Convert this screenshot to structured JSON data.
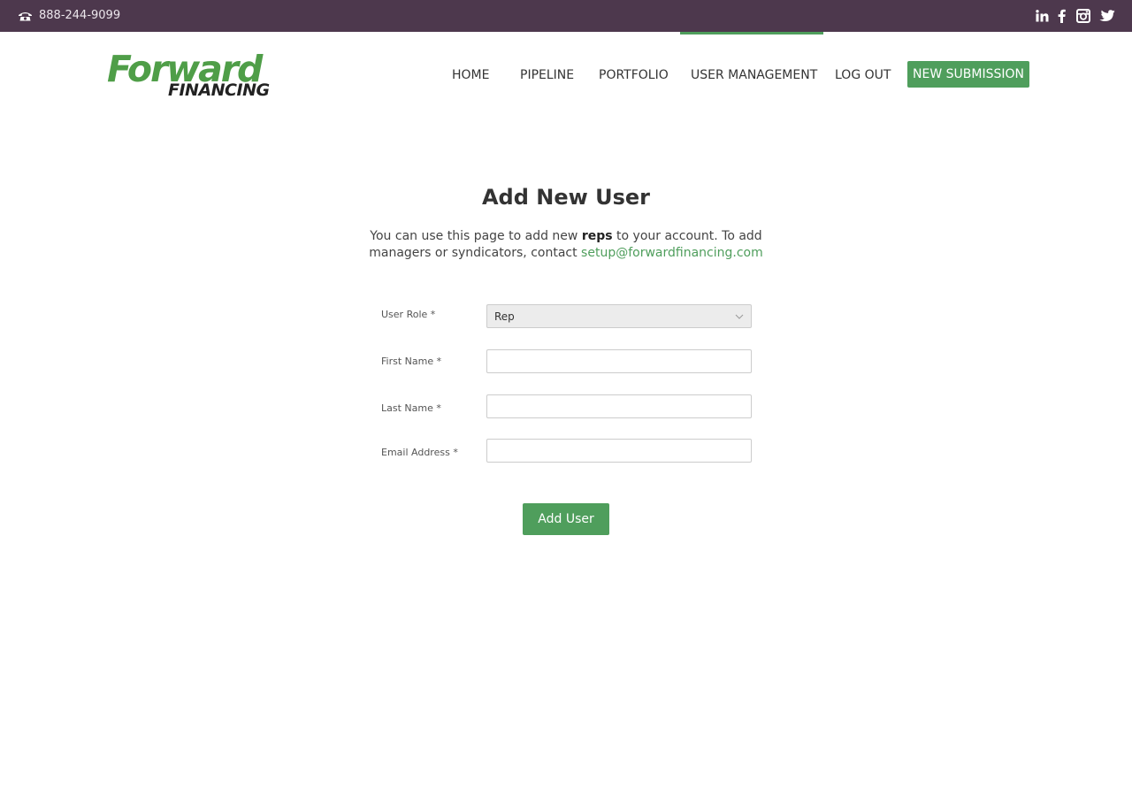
{
  "topbar": {
    "phone": "888-244-9099",
    "icons": [
      "phone-icon",
      "linkedin-icon",
      "facebook-icon",
      "instagram-icon",
      "twitter-icon"
    ]
  },
  "logo": {
    "line1": "Forward",
    "line2": "FINANCING"
  },
  "nav": {
    "items": [
      "HOME",
      "PIPELINE",
      "PORTFOLIO",
      "USER MANAGEMENT",
      "LOG OUT"
    ],
    "active": "USER MANAGEMENT",
    "cta": "NEW SUBMISSION"
  },
  "page": {
    "title": "Add New User",
    "intro_part1": "You can use this page to add new ",
    "intro_bold": "reps",
    "intro_part2": " to your account. To add managers or syndicators, contact ",
    "intro_email": "setup@forwardfinancing.com"
  },
  "form": {
    "role_label": "User Role *",
    "role_value": "Rep",
    "first_name_label": "First Name *",
    "first_name_value": "",
    "last_name_label": "Last Name *",
    "last_name_value": "",
    "email_label": "Email Address *",
    "email_value": "",
    "submit_label": "Add User"
  },
  "colors": {
    "topbar": "#4d384d",
    "accent_green": "#4f9e5c",
    "logo_green": "#4f9e48"
  }
}
